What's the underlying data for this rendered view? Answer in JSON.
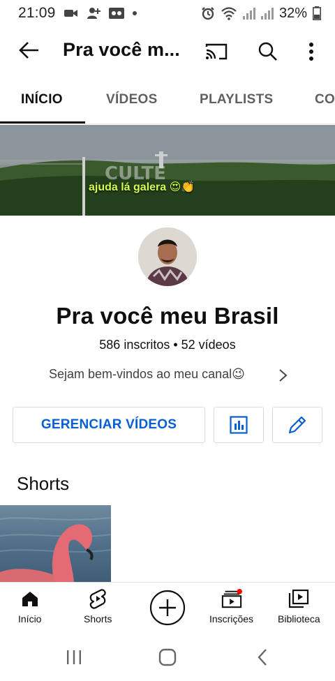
{
  "status_bar": {
    "time": "21:09",
    "battery": "32%",
    "icons": [
      "video-icon",
      "person-add-icon",
      "voicemail-icon",
      "dot-icon",
      "alarm-icon",
      "wifi-icon",
      "signal-icon",
      "signal-icon",
      "battery-icon"
    ]
  },
  "app_bar": {
    "title": "Pra você m...",
    "icons": [
      "back-arrow-icon",
      "cast-icon",
      "search-icon",
      "more-vert-icon"
    ]
  },
  "tabs": [
    {
      "label": "INÍCIO",
      "active": true
    },
    {
      "label": "VÍDEOS",
      "active": false
    },
    {
      "label": "PLAYLISTS",
      "active": false
    },
    {
      "label": "CO",
      "active": false
    }
  ],
  "banner": {
    "caption": "ajuda lá galera 😍👏"
  },
  "channel": {
    "name": "Pra você meu Brasil",
    "stats": "586 inscritos • 52 vídeos",
    "description": "Sejam bem-vindos ao meu canal😉"
  },
  "actions": {
    "manage_label": "GERENCIAR VÍDEOS",
    "analytics_icon": "bar-chart-icon",
    "edit_icon": "pencil-icon",
    "accent_color": "#065fd4"
  },
  "shorts": {
    "title": "Shorts"
  },
  "bottom_nav": {
    "items": [
      {
        "label": "Início",
        "icon": "home-icon"
      },
      {
        "label": "Shorts",
        "icon": "shorts-icon"
      },
      {
        "label": "",
        "icon": "create-plus-icon"
      },
      {
        "label": "Inscrições",
        "icon": "subscriptions-icon"
      },
      {
        "label": "Biblioteca",
        "icon": "library-icon"
      }
    ],
    "notification_color": "#ff0000"
  },
  "system_nav": {
    "icons": [
      "recents-icon",
      "home-button-icon",
      "back-icon"
    ]
  }
}
